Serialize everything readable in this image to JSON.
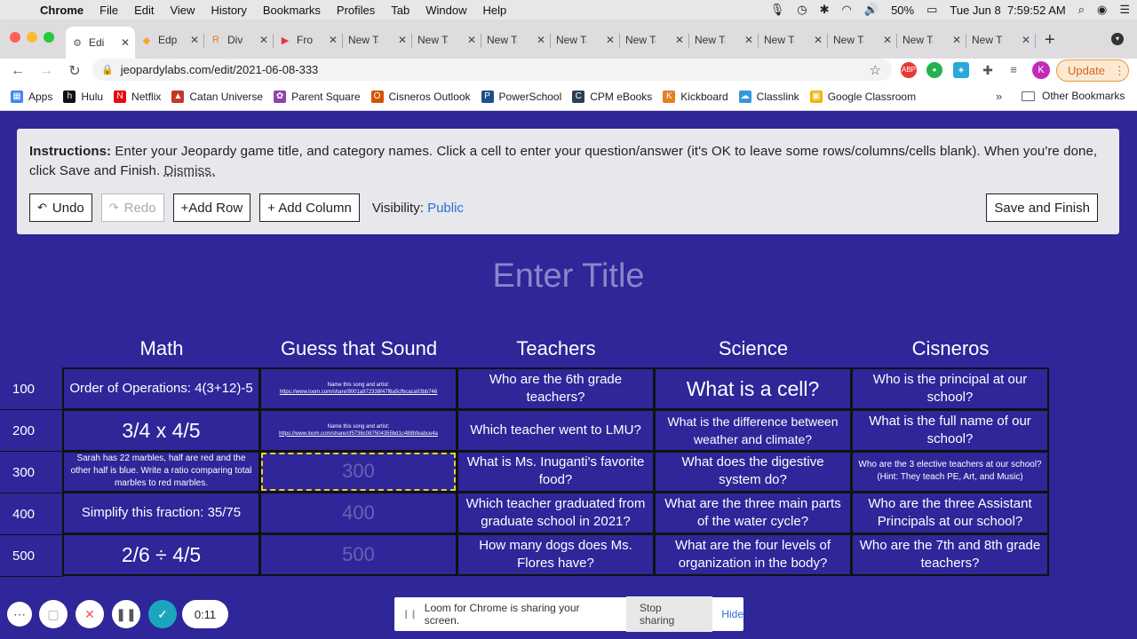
{
  "menubar": {
    "app": "Chrome",
    "items": [
      "File",
      "Edit",
      "View",
      "History",
      "Bookmarks",
      "Profiles",
      "Tab",
      "Window",
      "Help"
    ],
    "battery": "50%",
    "datetime": "Tue Jun 8  7:59:52 AM"
  },
  "tabs": [
    {
      "title": "Edi",
      "active": true
    },
    {
      "title": "Edp"
    },
    {
      "title": "Div"
    },
    {
      "title": "Fro"
    },
    {
      "title": "New Ta"
    },
    {
      "title": "New Ta"
    },
    {
      "title": "New Ta"
    },
    {
      "title": "New Ta"
    },
    {
      "title": "New Ta"
    },
    {
      "title": "New Ta"
    },
    {
      "title": "New Ta"
    },
    {
      "title": "New Ta"
    },
    {
      "title": "New Ta"
    },
    {
      "title": "New Ta"
    }
  ],
  "address": {
    "url": "jeopardylabs.com/edit/2021-06-08-333",
    "avatar": "K",
    "update_label": "Update"
  },
  "bookmarks": [
    {
      "label": "Apps",
      "color": "#4285f4",
      "glyph": "▦"
    },
    {
      "label": "Hulu",
      "color": "#111111",
      "glyph": "h"
    },
    {
      "label": "Netflix",
      "color": "#e50914",
      "glyph": "N"
    },
    {
      "label": "Catan Universe",
      "color": "#c0392b",
      "glyph": "▲"
    },
    {
      "label": "Parent Square",
      "color": "#8e44ad",
      "glyph": "✿"
    },
    {
      "label": "Cisneros Outlook",
      "color": "#d35400",
      "glyph": "O"
    },
    {
      "label": "PowerSchool",
      "color": "#1f4e8c",
      "glyph": "P"
    },
    {
      "label": "CPM eBooks",
      "color": "#2c3e50",
      "glyph": "C"
    },
    {
      "label": "Kickboard",
      "color": "#e67e22",
      "glyph": "K"
    },
    {
      "label": "Classlink",
      "color": "#3498db",
      "glyph": "☁"
    },
    {
      "label": "Google Classroom",
      "color": "#f4b400",
      "glyph": "▣"
    }
  ],
  "bookmarks_other": "Other Bookmarks",
  "instructions": {
    "lead": "Instructions:",
    "text": " Enter your Jeopardy game title, and category names. Click a cell to enter your question/answer (it's OK to leave some rows/columns/cells blank). When you're done, click Save and Finish. ",
    "dismiss": "Dismiss."
  },
  "toolbar": {
    "undo": "Undo",
    "redo": "Redo",
    "add_row": "+Add Row",
    "add_column": "+ Add Column",
    "visibility_label": "Visibility:",
    "visibility_value": "Public",
    "save": "Save and Finish"
  },
  "game": {
    "title_placeholder": "Enter Title",
    "categories": [
      "Math",
      "Guess that Sound",
      "Teachers",
      "Science",
      "Cisneros"
    ],
    "row_values": [
      "100",
      "200",
      "300",
      "400",
      "500"
    ],
    "cells": [
      [
        {
          "text": "Order of Operations: 4(3+12)-5",
          "style": "normal"
        },
        {
          "text": "Name this song and artist:",
          "url": "https://www.loom.com/share/9001a972338f47f6a5cfbcaca03bb746",
          "style": "tiny"
        },
        {
          "text": "Who are the 6th grade teachers?",
          "style": "normal"
        },
        {
          "text": "What is a cell?",
          "style": "big"
        },
        {
          "text": "Who is the principal at our school?",
          "style": "normal"
        }
      ],
      [
        {
          "text": "3/4 x 4/5",
          "style": "big"
        },
        {
          "text": "Name this song and artist:",
          "url": "https://www.loom.com/share/cf5736c087504355bd1c488bfeabce4a",
          "style": "tiny"
        },
        {
          "text": "Which teacher went to LMU?",
          "style": "normal"
        },
        {
          "text": "What is the difference between weather and climate?",
          "style": "normal-sm"
        },
        {
          "text": "What is the full name of our school?",
          "style": "normal"
        }
      ],
      [
        {
          "text": "Sarah has 22 marbles, half are red and the other half is blue. Write a ratio comparing total marbles to red marbles.",
          "style": "small"
        },
        {
          "text": "300",
          "style": "empty",
          "selected": true
        },
        {
          "text": "What is Ms. Inuganti's favorite food?",
          "style": "normal"
        },
        {
          "text": "What does the digestive system do?",
          "style": "normal"
        },
        {
          "text": "Who are the 3 elective teachers at our school? (Hint: They teach PE, Art, and Music)",
          "style": "small"
        }
      ],
      [
        {
          "text": "Simplify this fraction: 35/75",
          "style": "normal"
        },
        {
          "text": "400",
          "style": "empty"
        },
        {
          "text": "Which teacher graduated from graduate school in 2021?",
          "style": "normal"
        },
        {
          "text": "What are the three main parts of the water cycle?",
          "style": "normal"
        },
        {
          "text": "Who are the three Assistant Principals at our school?",
          "style": "normal"
        }
      ],
      [
        {
          "text": "2/6 ÷ 4/5",
          "style": "big"
        },
        {
          "text": "500",
          "style": "empty"
        },
        {
          "text": "How many dogs does Ms. Flores have?",
          "style": "normal"
        },
        {
          "text": "What are the four levels of organization in the body?",
          "style": "normal"
        },
        {
          "text": "Who are the 7th and 8th grade teachers?",
          "style": "normal"
        }
      ]
    ]
  },
  "recorder": {
    "timer": "0:11"
  },
  "loom_bar": {
    "message": "Loom for Chrome is sharing your screen.",
    "stop": "Stop sharing",
    "hide": "Hide"
  }
}
